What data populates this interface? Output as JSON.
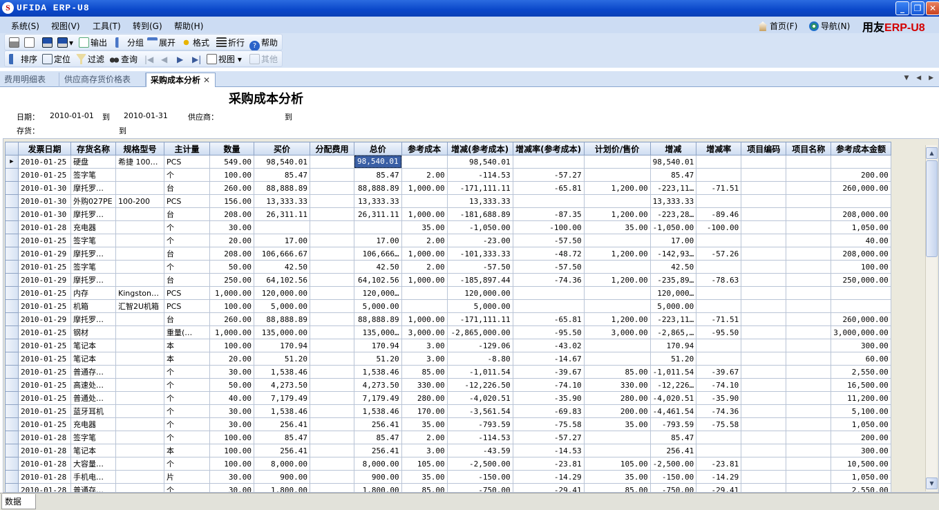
{
  "window": {
    "title": "UFIDA ERP-U8",
    "controls": {
      "minimize": "_",
      "maximize": "❐",
      "close": "✕"
    }
  },
  "menu": [
    {
      "label": "系统(S)"
    },
    {
      "label": "视图(V)"
    },
    {
      "label": "工具(T)"
    },
    {
      "label": "转到(G)"
    },
    {
      "label": "帮助(H)"
    }
  ],
  "right_links": {
    "home": "首页(F)",
    "nav": "导航(N)",
    "brand_a": "用友",
    "brand_b": "ERP-",
    "brand_c": "U8"
  },
  "toolbar1": {
    "output": "输出",
    "group": "分组",
    "expand": "展开",
    "format": "格式",
    "wrap": "折行",
    "help": "帮助"
  },
  "toolbar2": {
    "sort": "排序",
    "locate": "定位",
    "filter": "过滤",
    "query": "查询",
    "view": "视图",
    "other": "其他"
  },
  "tabs": [
    {
      "label": "费用明细表"
    },
    {
      "label": "供应商存货价格表"
    },
    {
      "label": "采购成本分析"
    }
  ],
  "report": {
    "title": "采购成本分析",
    "date_label": "日期：",
    "date_from": "2010-01-01",
    "to1": "到",
    "date_to": "2010-01-31",
    "supplier_label": "供应商：",
    "to2": "到",
    "inventory_label": "存货：",
    "to3": "到"
  },
  "columns": [
    "发票日期",
    "存货名称",
    "规格型号",
    "主计量",
    "数量",
    "买价",
    "分配费用",
    "总价",
    "参考成本",
    "增减(参考成本)",
    "增减率(参考成本)",
    "计划价/售价",
    "增减",
    "增减率",
    "项目编码",
    "项目名称",
    "参考成本金额"
  ],
  "rows": [
    [
      "2010-01-25",
      "硬盘",
      "希捷 100…",
      "PCS",
      "549.00",
      "98,540.01",
      "",
      "98,540.01",
      "",
      "98,540.01",
      "",
      "",
      "98,540.01",
      "",
      "",
      "",
      ""
    ],
    [
      "2010-01-25",
      "签字笔",
      "",
      "个",
      "100.00",
      "85.47",
      "",
      "85.47",
      "2.00",
      "-114.53",
      "-57.27",
      "",
      "85.47",
      "",
      "",
      "",
      "200.00"
    ],
    [
      "2010-01-30",
      "摩托罗…",
      "",
      "台",
      "260.00",
      "88,888.89",
      "",
      "88,888.89",
      "1,000.00",
      "-171,111.11",
      "-65.81",
      "1,200.00",
      "-223,11…",
      "-71.51",
      "",
      "",
      "260,000.00"
    ],
    [
      "2010-01-30",
      "外购027PE",
      "100-200",
      "PCS",
      "156.00",
      "13,333.33",
      "",
      "13,333.33",
      "",
      "13,333.33",
      "",
      "",
      "13,333.33",
      "",
      "",
      "",
      ""
    ],
    [
      "2010-01-30",
      "摩托罗…",
      "",
      "台",
      "208.00",
      "26,311.11",
      "",
      "26,311.11",
      "1,000.00",
      "-181,688.89",
      "-87.35",
      "1,200.00",
      "-223,28…",
      "-89.46",
      "",
      "",
      "208,000.00"
    ],
    [
      "2010-01-28",
      "充电器",
      "",
      "个",
      "30.00",
      "",
      "",
      "",
      "35.00",
      "-1,050.00",
      "-100.00",
      "35.00",
      "-1,050.00",
      "-100.00",
      "",
      "",
      "1,050.00"
    ],
    [
      "2010-01-25",
      "签字笔",
      "",
      "个",
      "20.00",
      "17.00",
      "",
      "17.00",
      "2.00",
      "-23.00",
      "-57.50",
      "",
      "17.00",
      "",
      "",
      "",
      "40.00"
    ],
    [
      "2010-01-29",
      "摩托罗…",
      "",
      "台",
      "208.00",
      "106,666.67",
      "",
      "106,666…",
      "1,000.00",
      "-101,333.33",
      "-48.72",
      "1,200.00",
      "-142,93…",
      "-57.26",
      "",
      "",
      "208,000.00"
    ],
    [
      "2010-01-25",
      "签字笔",
      "",
      "个",
      "50.00",
      "42.50",
      "",
      "42.50",
      "2.00",
      "-57.50",
      "-57.50",
      "",
      "42.50",
      "",
      "",
      "",
      "100.00"
    ],
    [
      "2010-01-29",
      "摩托罗…",
      "",
      "台",
      "250.00",
      "64,102.56",
      "",
      "64,102.56",
      "1,000.00",
      "-185,897.44",
      "-74.36",
      "1,200.00",
      "-235,89…",
      "-78.63",
      "",
      "",
      "250,000.00"
    ],
    [
      "2010-01-25",
      "内存",
      "Kingston…",
      "PCS",
      "1,000.00",
      "120,000.00",
      "",
      "120,000…",
      "",
      "120,000.00",
      "",
      "",
      "120,000…",
      "",
      "",
      "",
      ""
    ],
    [
      "2010-01-25",
      "机箱",
      "汇智2U机箱",
      "PCS",
      "100.00",
      "5,000.00",
      "",
      "5,000.00",
      "",
      "5,000.00",
      "",
      "",
      "5,000.00",
      "",
      "",
      "",
      ""
    ],
    [
      "2010-01-29",
      "摩托罗…",
      "",
      "台",
      "260.00",
      "88,888.89",
      "",
      "88,888.89",
      "1,000.00",
      "-171,111.11",
      "-65.81",
      "1,200.00",
      "-223,11…",
      "-71.51",
      "",
      "",
      "260,000.00"
    ],
    [
      "2010-01-25",
      "钢材",
      "",
      "重量(…",
      "1,000.00",
      "135,000.00",
      "",
      "135,000…",
      "3,000.00",
      "-2,865,000.00",
      "-95.50",
      "3,000.00",
      "-2,865,…",
      "-95.50",
      "",
      "",
      "3,000,000.00"
    ],
    [
      "2010-01-25",
      "笔记本",
      "",
      "本",
      "100.00",
      "170.94",
      "",
      "170.94",
      "3.00",
      "-129.06",
      "-43.02",
      "",
      "170.94",
      "",
      "",
      "",
      "300.00"
    ],
    [
      "2010-01-25",
      "笔记本",
      "",
      "本",
      "20.00",
      "51.20",
      "",
      "51.20",
      "3.00",
      "-8.80",
      "-14.67",
      "",
      "51.20",
      "",
      "",
      "",
      "60.00"
    ],
    [
      "2010-01-25",
      "普通存…",
      "",
      "个",
      "30.00",
      "1,538.46",
      "",
      "1,538.46",
      "85.00",
      "-1,011.54",
      "-39.67",
      "85.00",
      "-1,011.54",
      "-39.67",
      "",
      "",
      "2,550.00"
    ],
    [
      "2010-01-25",
      "高速处…",
      "",
      "个",
      "50.00",
      "4,273.50",
      "",
      "4,273.50",
      "330.00",
      "-12,226.50",
      "-74.10",
      "330.00",
      "-12,226…",
      "-74.10",
      "",
      "",
      "16,500.00"
    ],
    [
      "2010-01-25",
      "普通处…",
      "",
      "个",
      "40.00",
      "7,179.49",
      "",
      "7,179.49",
      "280.00",
      "-4,020.51",
      "-35.90",
      "280.00",
      "-4,020.51",
      "-35.90",
      "",
      "",
      "11,200.00"
    ],
    [
      "2010-01-25",
      "蓝牙耳机",
      "",
      "个",
      "30.00",
      "1,538.46",
      "",
      "1,538.46",
      "170.00",
      "-3,561.54",
      "-69.83",
      "200.00",
      "-4,461.54",
      "-74.36",
      "",
      "",
      "5,100.00"
    ],
    [
      "2010-01-25",
      "充电器",
      "",
      "个",
      "30.00",
      "256.41",
      "",
      "256.41",
      "35.00",
      "-793.59",
      "-75.58",
      "35.00",
      "-793.59",
      "-75.58",
      "",
      "",
      "1,050.00"
    ],
    [
      "2010-01-28",
      "签字笔",
      "",
      "个",
      "100.00",
      "85.47",
      "",
      "85.47",
      "2.00",
      "-114.53",
      "-57.27",
      "",
      "85.47",
      "",
      "",
      "",
      "200.00"
    ],
    [
      "2010-01-28",
      "笔记本",
      "",
      "本",
      "100.00",
      "256.41",
      "",
      "256.41",
      "3.00",
      "-43.59",
      "-14.53",
      "",
      "256.41",
      "",
      "",
      "",
      "300.00"
    ],
    [
      "2010-01-28",
      "大容量…",
      "",
      "个",
      "100.00",
      "8,000.00",
      "",
      "8,000.00",
      "105.00",
      "-2,500.00",
      "-23.81",
      "105.00",
      "-2,500.00",
      "-23.81",
      "",
      "",
      "10,500.00"
    ],
    [
      "2010-01-28",
      "手机电…",
      "",
      "片",
      "30.00",
      "900.00",
      "",
      "900.00",
      "35.00",
      "-150.00",
      "-14.29",
      "35.00",
      "-150.00",
      "-14.29",
      "",
      "",
      "1,050.00"
    ],
    [
      "2010-01-28",
      "普通存…",
      "",
      "个",
      "30.00",
      "1,800.00",
      "",
      "1,800.00",
      "85.00",
      "-750.00",
      "-29.41",
      "85.00",
      "-750.00",
      "-29.41",
      "",
      "",
      "2,550.00"
    ]
  ],
  "selected_cell": {
    "row": 0,
    "col": 7
  },
  "bottom_tab": "数据",
  "scroll": {
    "up": "▲",
    "down": "▼"
  },
  "tab_nav": "▼ ◀ ▶",
  "tab_close": "✕",
  "row_pointer": "▶"
}
